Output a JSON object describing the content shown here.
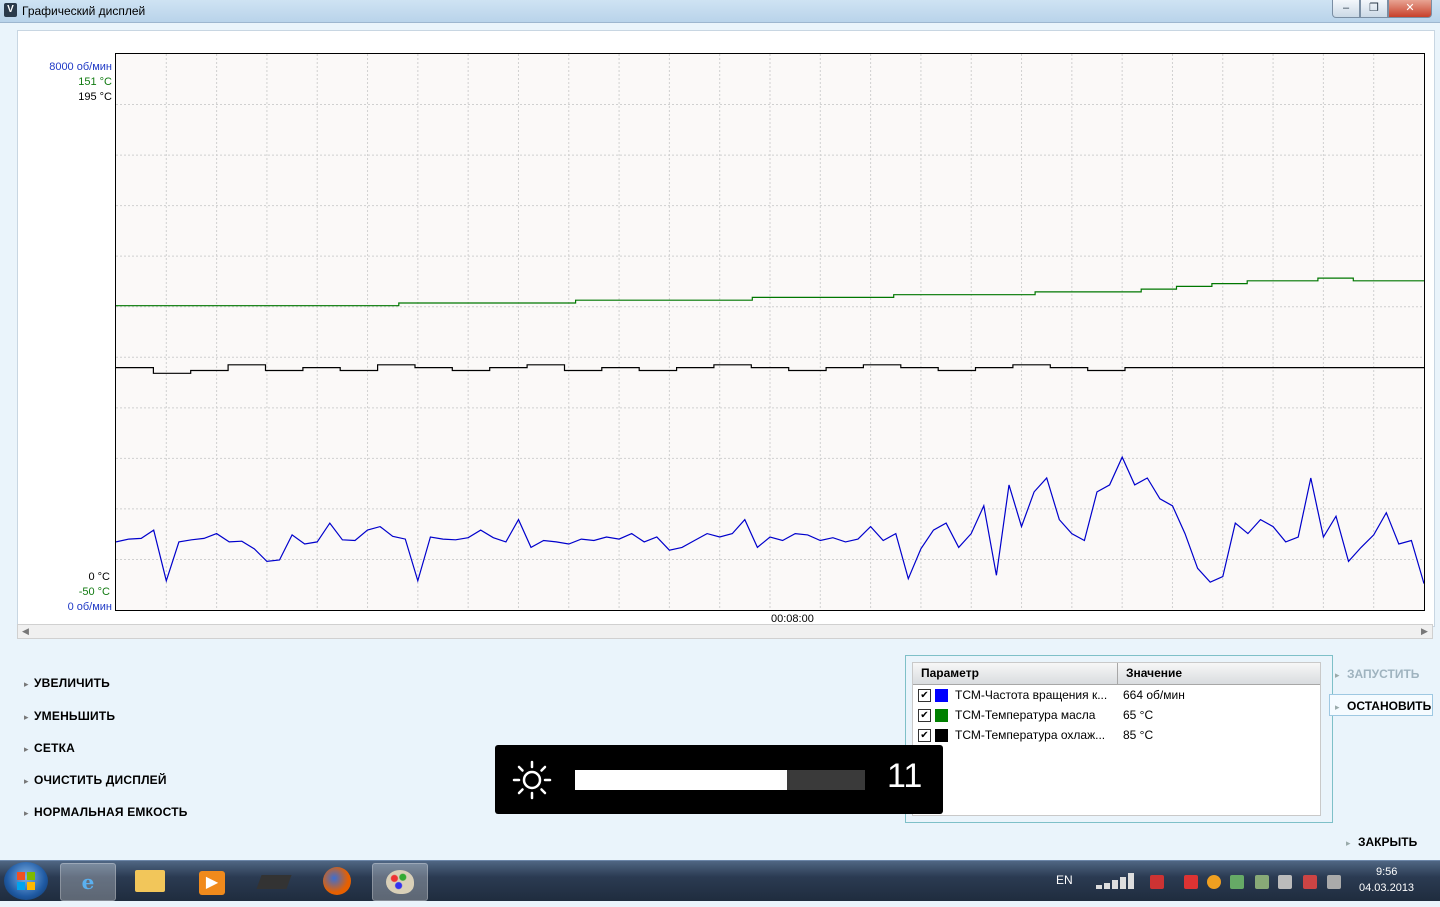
{
  "window": {
    "app_icon": "V",
    "title": "Графический дисплей",
    "minimize_icon": "minimize-icon",
    "maximize_icon": "maximize-icon",
    "close_icon": "close-icon"
  },
  "chart": {
    "axis_top_rpm": "8000 об/мин",
    "axis_top_oil": "151 °C",
    "axis_top_coolant": "195 °C",
    "axis_bottom_coolant": "0 °C",
    "axis_bottom_oil": "-50 °C",
    "axis_bottom_rpm": "0 об/мин",
    "time_label": "00:08:00"
  },
  "chart_data": {
    "type": "line",
    "x_label": "00:08:00",
    "grid": true,
    "series": [
      {
        "name": "ТСМ-Частота вращения к...",
        "color": "#0000cc",
        "unit": "об/мин",
        "range": [
          0,
          8000
        ],
        "values": [
          980,
          1020,
          1030,
          1150,
          420,
          980,
          1010,
          1030,
          1100,
          980,
          990,
          880,
          700,
          720,
          1080,
          950,
          980,
          1250,
          1010,
          1000,
          1150,
          1200,
          1060,
          1020,
          420,
          1050,
          1020,
          1010,
          1040,
          1150,
          1040,
          980,
          1300,
          900,
          1000,
          980,
          950,
          1020,
          1000,
          1050,
          1020,
          1100,
          980,
          1050,
          860,
          900,
          1000,
          1100,
          1050,
          1100,
          1300,
          900,
          1050,
          1000,
          1100,
          1080,
          1000,
          1040,
          980,
          1020,
          1200,
          1000,
          1100,
          450,
          880,
          1150,
          1250,
          900,
          1100,
          1500,
          500,
          1800,
          1200,
          1700,
          1900,
          1300,
          1100,
          1000,
          1700,
          1800,
          2200,
          1800,
          1900,
          1600,
          1500,
          1100,
          600,
          400,
          480,
          1250,
          1100,
          1300,
          1200,
          980,
          1050,
          1900,
          1050,
          1350,
          700,
          900,
          1080,
          1400,
          950,
          1000,
          380
        ]
      },
      {
        "name": "ТСМ-Температура масла",
        "color": "#007700",
        "unit": "°C",
        "range": [
          -50,
          151
        ],
        "values": [
          60,
          60,
          60,
          60,
          60,
          60,
          60,
          60,
          61,
          61,
          61,
          61,
          61,
          62,
          62,
          62,
          62,
          62,
          63,
          63,
          63,
          63,
          64,
          64,
          64,
          64,
          65,
          65,
          65,
          66,
          67,
          68,
          69,
          69,
          70,
          69,
          69,
          69
        ]
      },
      {
        "name": "ТСМ-Температура охлаж...",
        "color": "#000000",
        "unit": "°C",
        "range": [
          0,
          195
        ],
        "values": [
          85,
          83,
          84,
          86,
          84,
          85,
          84,
          86,
          85,
          84,
          85,
          86,
          84,
          85,
          84,
          85,
          86,
          85,
          84,
          85,
          86,
          85,
          84,
          85,
          86,
          85,
          84,
          85,
          85,
          85,
          85,
          85,
          85,
          85,
          85,
          85
        ]
      }
    ]
  },
  "menu": {
    "zoom_in": "УВЕЛИЧИТЬ",
    "zoom_out": "УМЕНЬШИТЬ",
    "grid": "СЕТКА",
    "clear": "ОЧИСТИТЬ ДИСПЛЕЙ",
    "normal": "НОРМАЛЬНАЯ ЕМКОСТЬ"
  },
  "params": {
    "col_param": "Параметр",
    "col_value": "Значение",
    "rows": [
      {
        "name": "ТСМ-Частота вращения к...",
        "value": "664 об/мин",
        "color": "#0000ff",
        "checked": "✔"
      },
      {
        "name": "ТСМ-Температура масла",
        "value": "65 °C",
        "color": "#008000",
        "checked": "✔"
      },
      {
        "name": "ТСМ-Температура охлаж...",
        "value": "85 °C",
        "color": "#000000",
        "checked": "✔"
      }
    ]
  },
  "buttons": {
    "start": "ЗАПУСТИТЬ",
    "stop": "ОСТАНОВИТЬ",
    "close": "ЗАКРЫТЬ"
  },
  "osd": {
    "icon": "brightness-icon",
    "value": "11",
    "level": 0.73
  },
  "taskbar": {
    "lang": "EN",
    "time": "9:56",
    "date": "04.03.2013"
  }
}
